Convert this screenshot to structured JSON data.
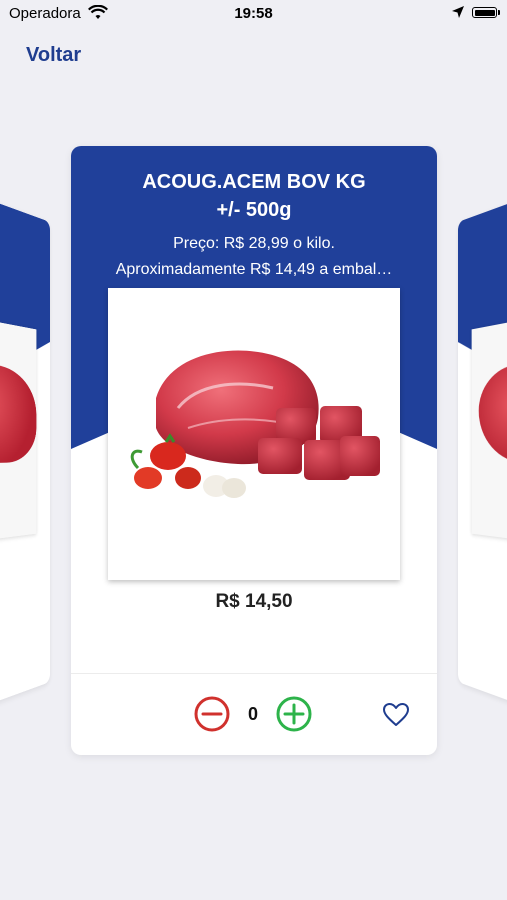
{
  "status_bar": {
    "carrier": "Operadora",
    "time": "19:58"
  },
  "nav": {
    "back_label": "Voltar"
  },
  "product": {
    "title_line1": "ACOUG.ACEM BOV KG",
    "title_line2": "+/- 500g",
    "price_per_kilo": "Preço: R$ 28,99 o kilo.",
    "approx_price": "Aproximadamente R$ 14,49 a embal…",
    "price": "R$ 14,50",
    "quantity": "0"
  },
  "colors": {
    "brand_blue": "#20409a",
    "minus_red": "#d0312d",
    "plus_green": "#2db34a",
    "link_blue": "#1f3d8f"
  },
  "icons": [
    "wifi-icon",
    "location-arrow-icon",
    "battery-icon",
    "minus-circle-icon",
    "plus-circle-icon",
    "heart-icon"
  ]
}
